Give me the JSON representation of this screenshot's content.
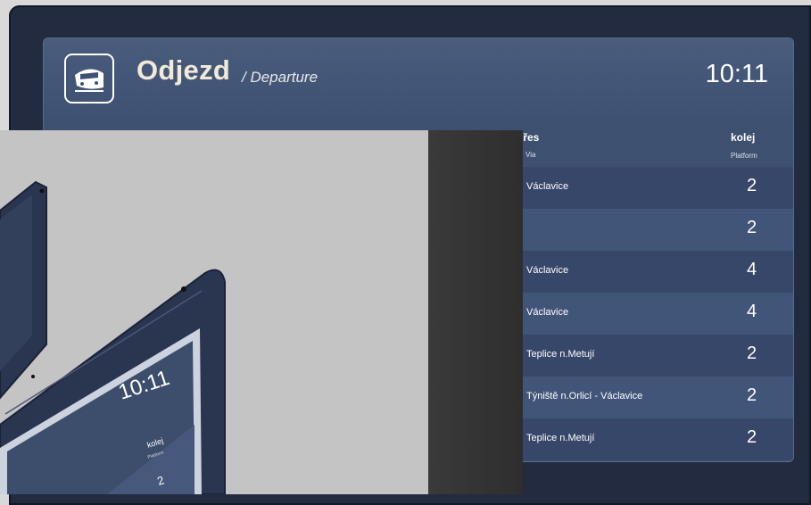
{
  "board": {
    "title": "Odjezd",
    "subtitle": "/ Departure",
    "time": "10:11"
  },
  "columns": {
    "via": "přes",
    "via_en": "Via",
    "platform": "kolej",
    "platform_en": "Platform"
  },
  "rows": [
    {
      "via": "Václavice",
      "platform": "2"
    },
    {
      "via": "",
      "platform": "2"
    },
    {
      "via": "Václavice",
      "platform": "4"
    },
    {
      "via": "Václavice",
      "platform": "4"
    },
    {
      "via": "Teplice n.Metují",
      "platform": "2"
    },
    {
      "via": "Týniště n.Orlicí - Václavice",
      "platform": "2"
    },
    {
      "via": "Teplice n.Metují",
      "platform": "2"
    }
  ],
  "device": {
    "time": "10:11",
    "platform": "kolej",
    "platform_en": "Platform",
    "row_platform": "2"
  },
  "colors": {
    "screen": "#3e5070",
    "row_dark": "#37476a",
    "row_light": "#415579",
    "title": "#f2ead8"
  }
}
